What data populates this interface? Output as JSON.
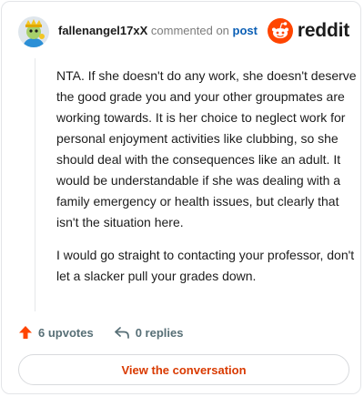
{
  "header": {
    "username": "fallenangel17xX",
    "commented_text": "commented on",
    "post_link": "post",
    "brand_name": "reddit"
  },
  "comment": {
    "paragraphs": [
      "NTA. If she doesn't do any work, she doesn't deserve the good grade you and your other groupmates are working towards. It is her choice to neglect work for personal enjoyment activities like clubbing, so she should deal with the consequences like an adult. It would be understandable if she was dealing with a family emergency or health issues, but clearly that isn't the situation here.",
      "I would go straight to contacting your professor, don't let a slacker pull your grades down."
    ]
  },
  "actions": {
    "upvotes_label": "6 upvotes",
    "replies_label": "0 replies"
  },
  "footer": {
    "view_button_label": "View the conversation"
  },
  "colors": {
    "brand": "#ff4500",
    "upvote": "#ff4500",
    "link": "#0b5fb5",
    "button_text": "#d93a00"
  },
  "icons": {
    "avatar": "snoo-avatar",
    "brand": "reddit-logo-icon",
    "upvote": "upvote-arrow-icon",
    "reply": "reply-arrow-icon"
  }
}
